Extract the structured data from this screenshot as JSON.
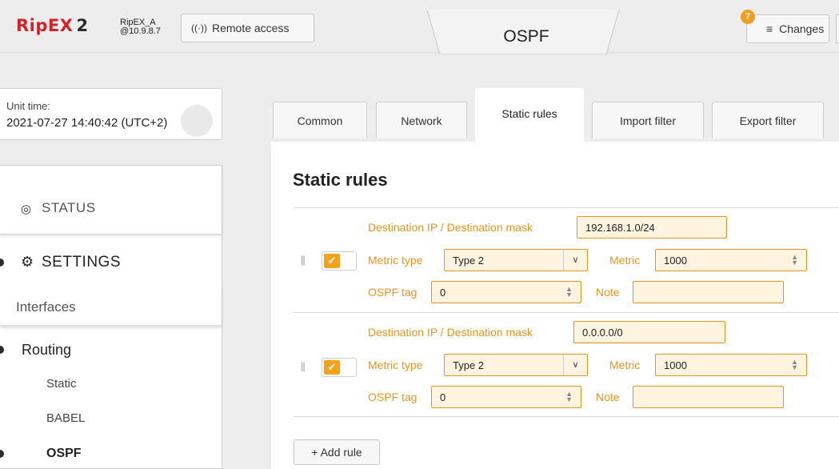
{
  "header": {
    "logo": "RipEX",
    "logo_suffix": "2",
    "unit_name": "RipEX_A",
    "unit_ip": "@10.9.8.7",
    "remote_access_label": "Remote access",
    "page_title": "OSPF",
    "changes_label": "Changes",
    "changes_count": "7"
  },
  "unit_time": {
    "label": "Unit time:",
    "value": "2021-07-27 14:40:42 (UTC+2)"
  },
  "sidebar": {
    "status_label": "STATUS",
    "settings_label": "SETTINGS",
    "interfaces_label": "Interfaces",
    "routing_label": "Routing",
    "routing_items": [
      "Static",
      "BABEL"
    ],
    "ospf_label": "OSPF"
  },
  "tabs": [
    {
      "label": "Common"
    },
    {
      "label": "Network"
    },
    {
      "label": "Static rules"
    },
    {
      "label": "Import filter"
    },
    {
      "label": "Export filter"
    }
  ],
  "active_tab": "Static rules",
  "content": {
    "title": "Static rules",
    "labels": {
      "destination": "Destination IP / Destination mask",
      "metric_type": "Metric type",
      "metric": "Metric",
      "ospf_tag": "OSPF tag",
      "note": "Note"
    },
    "rules": [
      {
        "enabled": true,
        "destination": "192.168.1.0/24",
        "metric_type": "Type 2",
        "metric": "1000",
        "ospf_tag": "0",
        "note": ""
      },
      {
        "enabled": true,
        "destination": "0.0.0.0/0",
        "metric_type": "Type 2",
        "metric": "1000",
        "ospf_tag": "0",
        "note": ""
      }
    ],
    "add_rule_label": "Add rule"
  },
  "colors": {
    "brand_red": "#d3222a",
    "accent_orange": "#e8941c",
    "field_bg": "#fff4e0"
  }
}
